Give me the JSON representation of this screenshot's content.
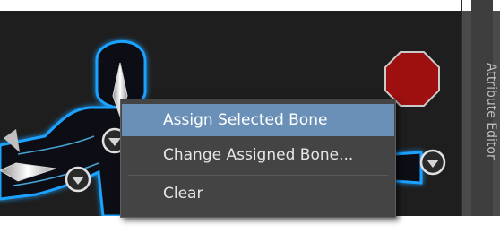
{
  "context_menu": {
    "items": [
      {
        "label": "Assign Selected Bone",
        "highlighted": true
      },
      {
        "label": "Change Assigned Bone...",
        "highlighted": false
      },
      {
        "label": "Clear",
        "highlighted": false
      },
      {
        "label": "",
        "highlighted": false
      }
    ]
  },
  "side_panel": {
    "tab_label": "Attribute Editor"
  },
  "colors": {
    "viewport_bg": "#1e1e1e",
    "figure_glow": "#1fa2ff",
    "stop_button": "#9e1010",
    "menu_bg": "#444444",
    "menu_highlight": "#6a90b8"
  },
  "icons": {
    "stop": "stop-octagon-icon",
    "selector": "chevron-down-circle-icon"
  }
}
